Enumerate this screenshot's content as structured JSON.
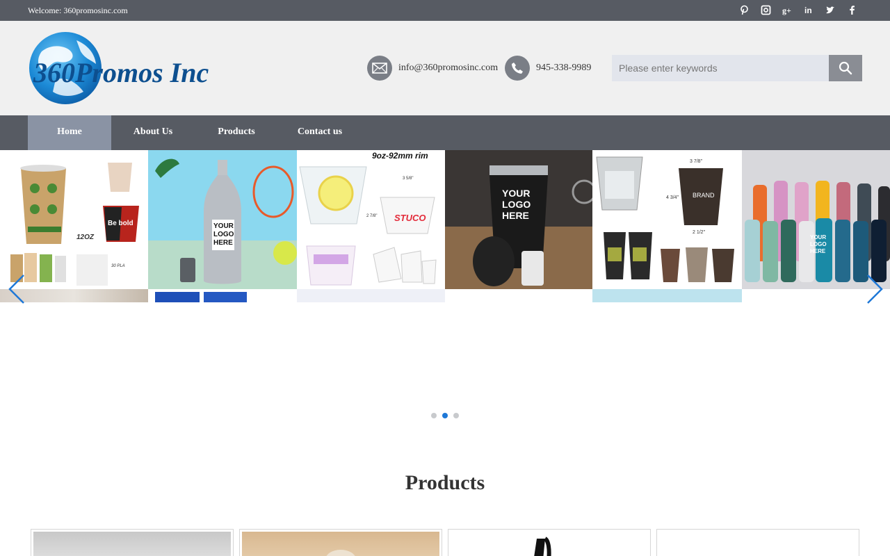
{
  "topbar": {
    "welcome": "Welcome: 360promosinc.com",
    "social_icons": [
      "pinterest-icon",
      "instagram-icon",
      "google-plus-icon",
      "linkedin-icon",
      "twitter-icon",
      "facebook-icon"
    ],
    "social_glyphs": [
      "𝓅",
      "◘",
      "g+",
      "in",
      "t",
      "f"
    ]
  },
  "header": {
    "logo_text": "360Promos Inc",
    "email": "info@360promosinc.com",
    "phone": "945-338-9989",
    "search_placeholder": "Please enter keywords"
  },
  "nav": {
    "items": [
      {
        "label": "Home",
        "active": true
      },
      {
        "label": "About Us",
        "active": false
      },
      {
        "label": "Products",
        "active": false
      },
      {
        "label": "Contact us",
        "active": false
      }
    ]
  },
  "carousel": {
    "tiles": [
      {
        "name": "paper-cups",
        "text": "12OZ",
        "text2": "Be bold",
        "text3": "30 PLA"
      },
      {
        "name": "steel-bottle",
        "text": "YOUR",
        "text2": "LOGO",
        "text3": "HERE"
      },
      {
        "name": "plastic-cups",
        "text": "9oz-92mm rim",
        "text2": "3 5/8\"",
        "text3": "2 7/8\"",
        "text4": "STUCO"
      },
      {
        "name": "black-tumbler",
        "text": "YOUR",
        "text2": "LOGO",
        "text3": "HERE"
      },
      {
        "name": "brand-cups",
        "text": "3 7/8\"",
        "text2": "4 3/4\"",
        "text3": "2 1/2\"",
        "text4": "BRAND"
      },
      {
        "name": "colored-bottles",
        "text": "YOUR",
        "text2": "LOGO",
        "text3": "HERE"
      }
    ],
    "dots": 3,
    "active_dot": 1
  },
  "products": {
    "title": "Products"
  },
  "colors": {
    "topbar": "#575b63",
    "nav_active": "#8a93a4",
    "accent": "#1e78d7"
  }
}
